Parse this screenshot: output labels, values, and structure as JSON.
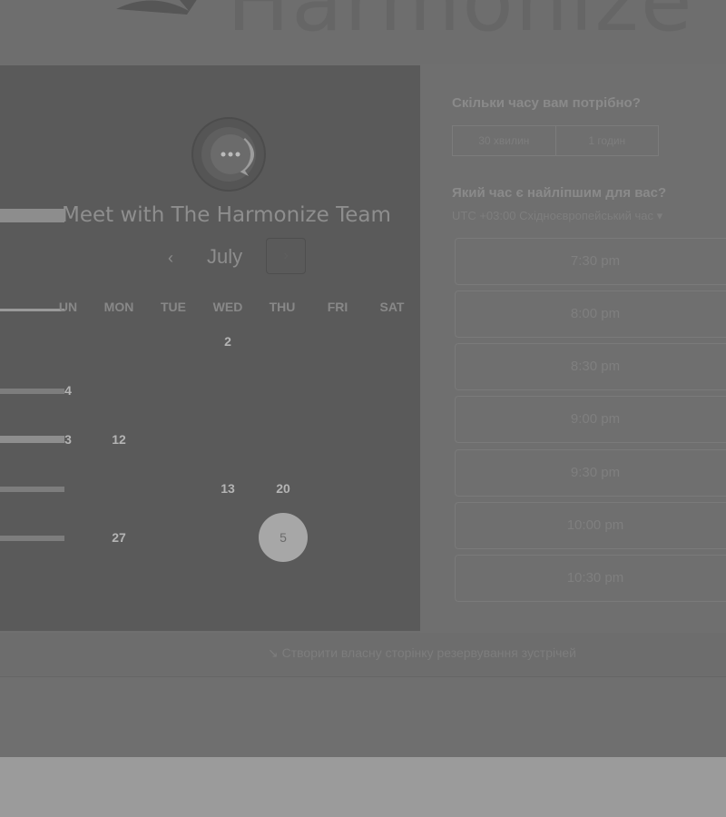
{
  "page": {
    "title": "Meet with The Harmonize Team",
    "logo_text": "Harmonize"
  },
  "calendar": {
    "month": "July",
    "prev_symbol": "‹",
    "next_symbol": "›",
    "weekdays": [
      "UN",
      "MON",
      "TUE",
      "WED",
      "THU",
      "FRI",
      "SAT"
    ],
    "rows": [
      [
        {
          "label": "",
          "state": "muted"
        },
        {
          "label": "",
          "state": "muted"
        },
        {
          "label": "",
          "state": "muted"
        },
        {
          "label": "2",
          "state": "available"
        },
        {
          "label": "",
          "state": "muted"
        },
        {
          "label": "",
          "state": "muted"
        },
        {
          "label": "",
          "state": "muted"
        }
      ],
      [
        {
          "label": "4",
          "state": "available"
        },
        {
          "label": "",
          "state": "muted"
        },
        {
          "label": "",
          "state": "muted"
        },
        {
          "label": "",
          "state": "muted"
        },
        {
          "label": "",
          "state": "muted"
        },
        {
          "label": "",
          "state": "muted"
        },
        {
          "label": "",
          "state": "muted"
        }
      ],
      [
        {
          "label": "3",
          "state": "available"
        },
        {
          "label": "12",
          "state": "available"
        },
        {
          "label": "",
          "state": "muted"
        },
        {
          "label": "",
          "state": "muted"
        },
        {
          "label": "",
          "state": "muted"
        },
        {
          "label": "",
          "state": "muted"
        },
        {
          "label": "",
          "state": "muted"
        }
      ],
      [
        {
          "label": "",
          "state": "muted"
        },
        {
          "label": "",
          "state": "muted"
        },
        {
          "label": "",
          "state": "muted"
        },
        {
          "label": "13",
          "state": "available"
        },
        {
          "label": "20",
          "state": "available"
        },
        {
          "label": "",
          "state": "muted"
        },
        {
          "label": "",
          "state": "muted"
        }
      ],
      [
        {
          "label": "",
          "state": "muted"
        },
        {
          "label": "27",
          "state": "available"
        },
        {
          "label": "",
          "state": "muted"
        },
        {
          "label": "",
          "state": "muted"
        },
        {
          "label": "5",
          "state": "selected"
        },
        {
          "label": "",
          "state": "muted"
        },
        {
          "label": "",
          "state": "muted"
        }
      ]
    ]
  },
  "duration": {
    "heading": "Скільки часу вам потрібно?",
    "options": [
      "30 хвилин",
      "1 годин"
    ]
  },
  "time_picker": {
    "heading": "Який час є найліпшим для вас?",
    "timezone": "UTC +03:00 Східноєвропейський час ▾",
    "slots": [
      "7:30 pm",
      "8:00 pm",
      "8:30 pm",
      "9:00 pm",
      "9:30 pm",
      "10:00 pm",
      "10:30 pm"
    ]
  },
  "footer": {
    "link": "↘ Створити власну сторінку резервування зустрічей"
  },
  "colors": {
    "overlay_background": "#6f6f6f",
    "calendar_panel": "#5a5a5a",
    "selected_day": "#a7a7a7"
  }
}
